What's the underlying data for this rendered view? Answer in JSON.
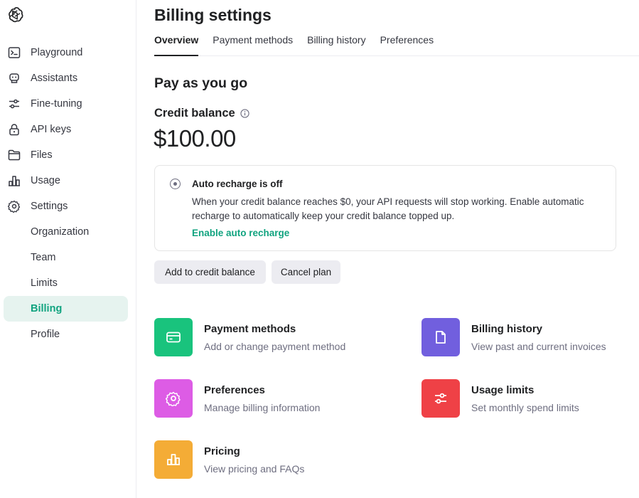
{
  "sidebar": {
    "logo": "openai-logo",
    "items": [
      {
        "label": "Playground",
        "icon": "terminal-icon"
      },
      {
        "label": "Assistants",
        "icon": "robot-icon"
      },
      {
        "label": "Fine-tuning",
        "icon": "sliders-icon"
      },
      {
        "label": "API keys",
        "icon": "lock-icon"
      },
      {
        "label": "Files",
        "icon": "folder-icon"
      },
      {
        "label": "Usage",
        "icon": "bar-chart-icon"
      },
      {
        "label": "Settings",
        "icon": "gear-icon"
      }
    ],
    "sub_items": [
      {
        "label": "Organization"
      },
      {
        "label": "Team"
      },
      {
        "label": "Limits"
      },
      {
        "label": "Billing",
        "active": true
      },
      {
        "label": "Profile"
      }
    ]
  },
  "header": {
    "title": "Billing settings",
    "tabs": [
      {
        "label": "Overview",
        "active": true
      },
      {
        "label": "Payment methods"
      },
      {
        "label": "Billing history"
      },
      {
        "label": "Preferences"
      }
    ]
  },
  "main": {
    "section_title": "Pay as you go",
    "credit_label": "Credit balance",
    "credit_amount": "$100.00",
    "recharge": {
      "title": "Auto recharge is off",
      "description": "When your credit balance reaches $0, your API requests will stop working. Enable automatic recharge to automatically keep your credit balance topped up.",
      "link": "Enable auto recharge"
    },
    "buttons": {
      "add": "Add to credit balance",
      "cancel": "Cancel plan"
    },
    "quick_links": [
      {
        "title": "Payment methods",
        "desc": "Add or change payment method",
        "color": "#19c37d",
        "icon": "credit-card-icon"
      },
      {
        "title": "Billing history",
        "desc": "View past and current invoices",
        "color": "#715fde",
        "icon": "document-icon"
      },
      {
        "title": "Preferences",
        "desc": "Manage billing information",
        "color": "#dd5ce5",
        "icon": "gear-icon"
      },
      {
        "title": "Usage limits",
        "desc": "Set monthly spend limits",
        "color": "#ef4146",
        "icon": "sliders-icon"
      },
      {
        "title": "Pricing",
        "desc": "View pricing and FAQs",
        "color": "#f4ac36",
        "icon": "bar-chart-icon"
      }
    ]
  },
  "colors": {
    "accent": "#10a37f",
    "active_bg": "#e6f3ef"
  }
}
